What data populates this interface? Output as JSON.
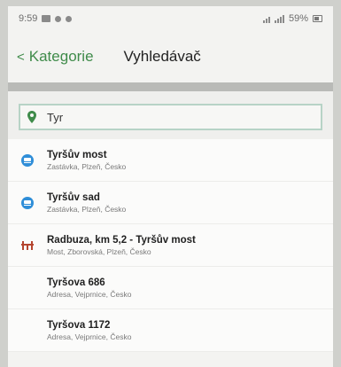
{
  "status_bar": {
    "time": "9:59",
    "battery": "59%"
  },
  "nav": {
    "back_label": "Kategorie",
    "title": "Vyhledávač"
  },
  "search": {
    "value": "Tyr"
  },
  "results": [
    {
      "icon": "bus-stop-icon",
      "title": "Tyršův most",
      "subtitle": "Zastávka, Plzeň, Česko"
    },
    {
      "icon": "bus-stop-icon",
      "title": "Tyršův sad",
      "subtitle": "Zastávka, Plzeň, Česko"
    },
    {
      "icon": "bridge-icon",
      "title": "Radbuza, km 5,2 - Tyršův most",
      "subtitle": "Most, Zborovská, Plzeň, Česko"
    },
    {
      "icon": "none",
      "title": "Tyršova 686",
      "subtitle": "Adresa, Vejprnice, Česko"
    },
    {
      "icon": "none",
      "title": "Tyršova 1172",
      "subtitle": "Adresa, Vejprnice, Česko"
    }
  ],
  "colors": {
    "accent": "#3f8b4a",
    "bus": "#2f8ed8",
    "bridge": "#b5452f"
  }
}
